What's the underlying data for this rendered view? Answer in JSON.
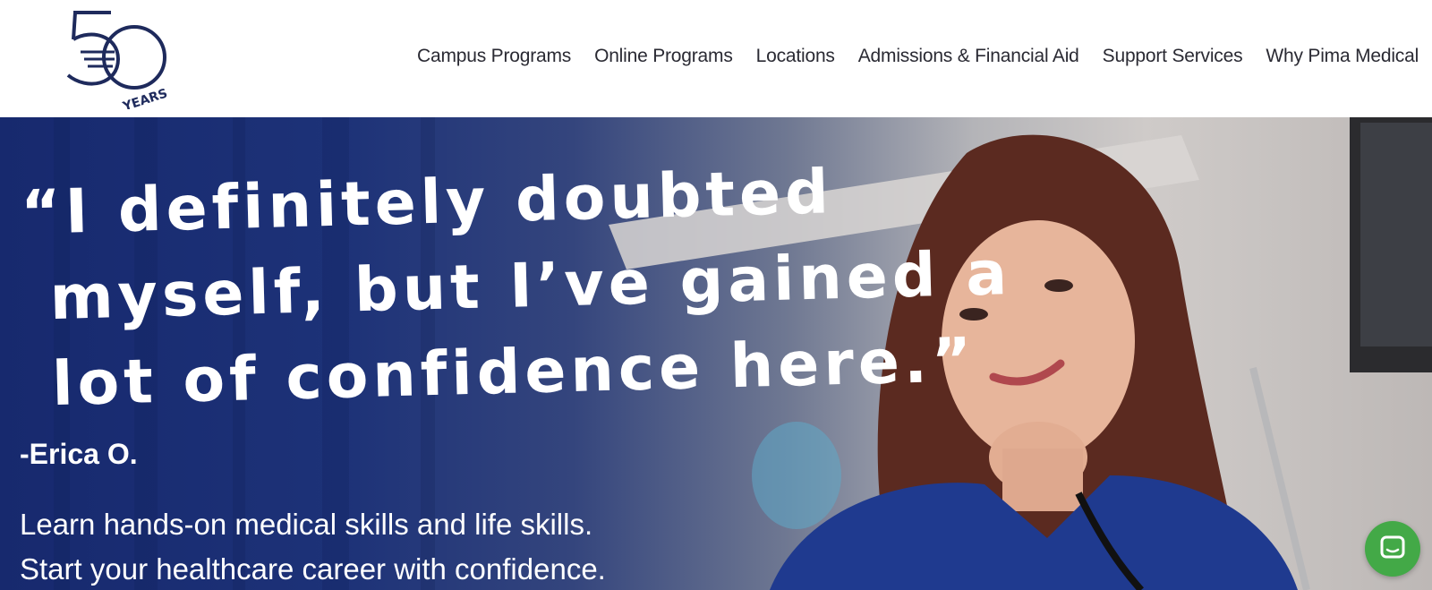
{
  "header": {
    "logo": {
      "number": "50",
      "label": "YEARS",
      "icon": "50-years-logo-icon"
    },
    "nav": [
      {
        "label": "Campus Programs"
      },
      {
        "label": "Online Programs"
      },
      {
        "label": "Locations"
      },
      {
        "label": "Admissions & Financial Aid"
      },
      {
        "label": "Support Services"
      },
      {
        "label": "Why Pima Medical"
      }
    ]
  },
  "hero": {
    "quote_lines": [
      "“I definitely doubted",
      "myself, but I’ve gained a",
      "lot of confidence here.”"
    ],
    "author": "-Erica O.",
    "tagline_lines": [
      "Learn hands-on medical skills and life skills.",
      "Start your healthcare career with confidence."
    ]
  },
  "chat": {
    "icon": "chat-icon"
  },
  "colors": {
    "brand_navy": "#17296e",
    "chat_green": "#43a947",
    "accent_orange": "#f2a23a",
    "accent_teal": "#c6e7e4"
  }
}
